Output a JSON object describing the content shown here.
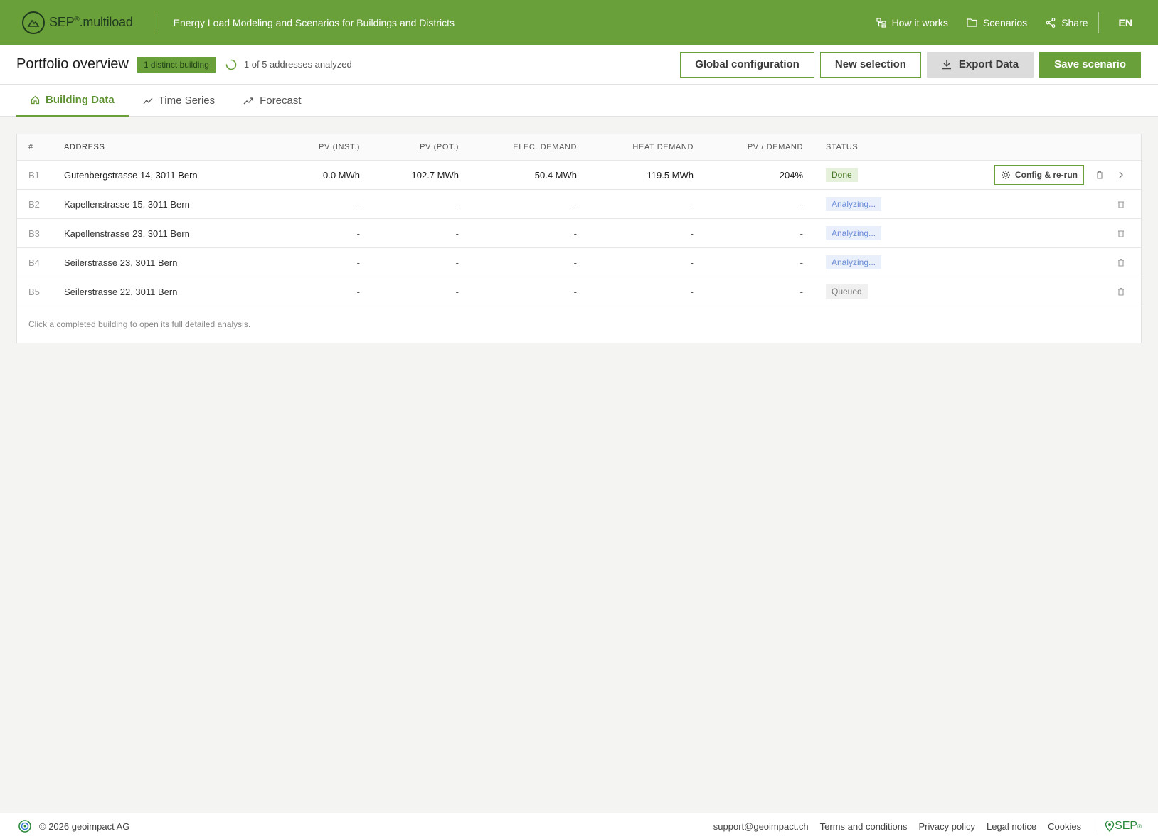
{
  "topbar": {
    "logo_text": "SEP",
    "logo_reg": "®",
    "logo_suffix": ".multiload",
    "tagline": "Energy Load Modeling and Scenarios for Buildings and Districts",
    "nav": [
      {
        "label": "How it works",
        "icon": "sitemap-icon"
      },
      {
        "label": "Scenarios",
        "icon": "folder-icon"
      },
      {
        "label": "Share",
        "icon": "share-icon"
      }
    ],
    "language": "EN"
  },
  "header": {
    "title": "Portfolio overview",
    "badge": "1 distinct building",
    "progress_text": "1 of 5 addresses analyzed",
    "buttons": {
      "global_config": "Global configuration",
      "new_selection": "New selection",
      "export": "Export Data",
      "save": "Save scenario"
    }
  },
  "tabs": [
    {
      "label": "Building Data",
      "icon": "home-icon",
      "active": true
    },
    {
      "label": "Time Series",
      "icon": "line-chart-icon",
      "active": false
    },
    {
      "label": "Forecast",
      "icon": "trend-up-icon",
      "active": false
    }
  ],
  "table": {
    "columns": {
      "num": "#",
      "address": "ADDRESS",
      "pv_inst": "PV (INST.)",
      "pv_pot": "PV (POT.)",
      "elec": "ELEC. DEMAND",
      "heat": "HEAT DEMAND",
      "ratio": "PV / DEMAND",
      "status": "STATUS"
    },
    "rows": [
      {
        "id": "B1",
        "address": "Gutenbergstrasse 14, 3011 Bern",
        "pv_inst": "0.0 MWh",
        "pv_pot": "102.7 MWh",
        "elec": "50.4 MWh",
        "heat": "119.5 MWh",
        "ratio": "204%",
        "status": "Done"
      },
      {
        "id": "B2",
        "address": "Kapellenstrasse 15, 3011 Bern",
        "pv_inst": "-",
        "pv_pot": "-",
        "elec": "-",
        "heat": "-",
        "ratio": "-",
        "status": "Analyzing..."
      },
      {
        "id": "B3",
        "address": "Kapellenstrasse 23, 3011 Bern",
        "pv_inst": "-",
        "pv_pot": "-",
        "elec": "-",
        "heat": "-",
        "ratio": "-",
        "status": "Analyzing..."
      },
      {
        "id": "B4",
        "address": "Seilerstrasse 23, 3011 Bern",
        "pv_inst": "-",
        "pv_pot": "-",
        "elec": "-",
        "heat": "-",
        "ratio": "-",
        "status": "Analyzing..."
      },
      {
        "id": "B5",
        "address": "Seilerstrasse 22, 3011 Bern",
        "pv_inst": "-",
        "pv_pot": "-",
        "elec": "-",
        "heat": "-",
        "ratio": "-",
        "status": "Queued"
      }
    ],
    "config_button": "Config & re-run",
    "hint": "Click a completed building to open its full detailed analysis."
  },
  "footer": {
    "copyright": "© 2026 geoimpact AG",
    "links": [
      "support@geoimpact.ch",
      "Terms and conditions",
      "Privacy policy",
      "Legal notice",
      "Cookies"
    ],
    "sep_logo": "SEP",
    "sep_reg": "®"
  },
  "colors": {
    "brand_green": "#6aa039",
    "done_bg": "#e6f1dc",
    "analyzing_bg": "#eaf0fb",
    "queued_bg": "#f0f0f0"
  }
}
